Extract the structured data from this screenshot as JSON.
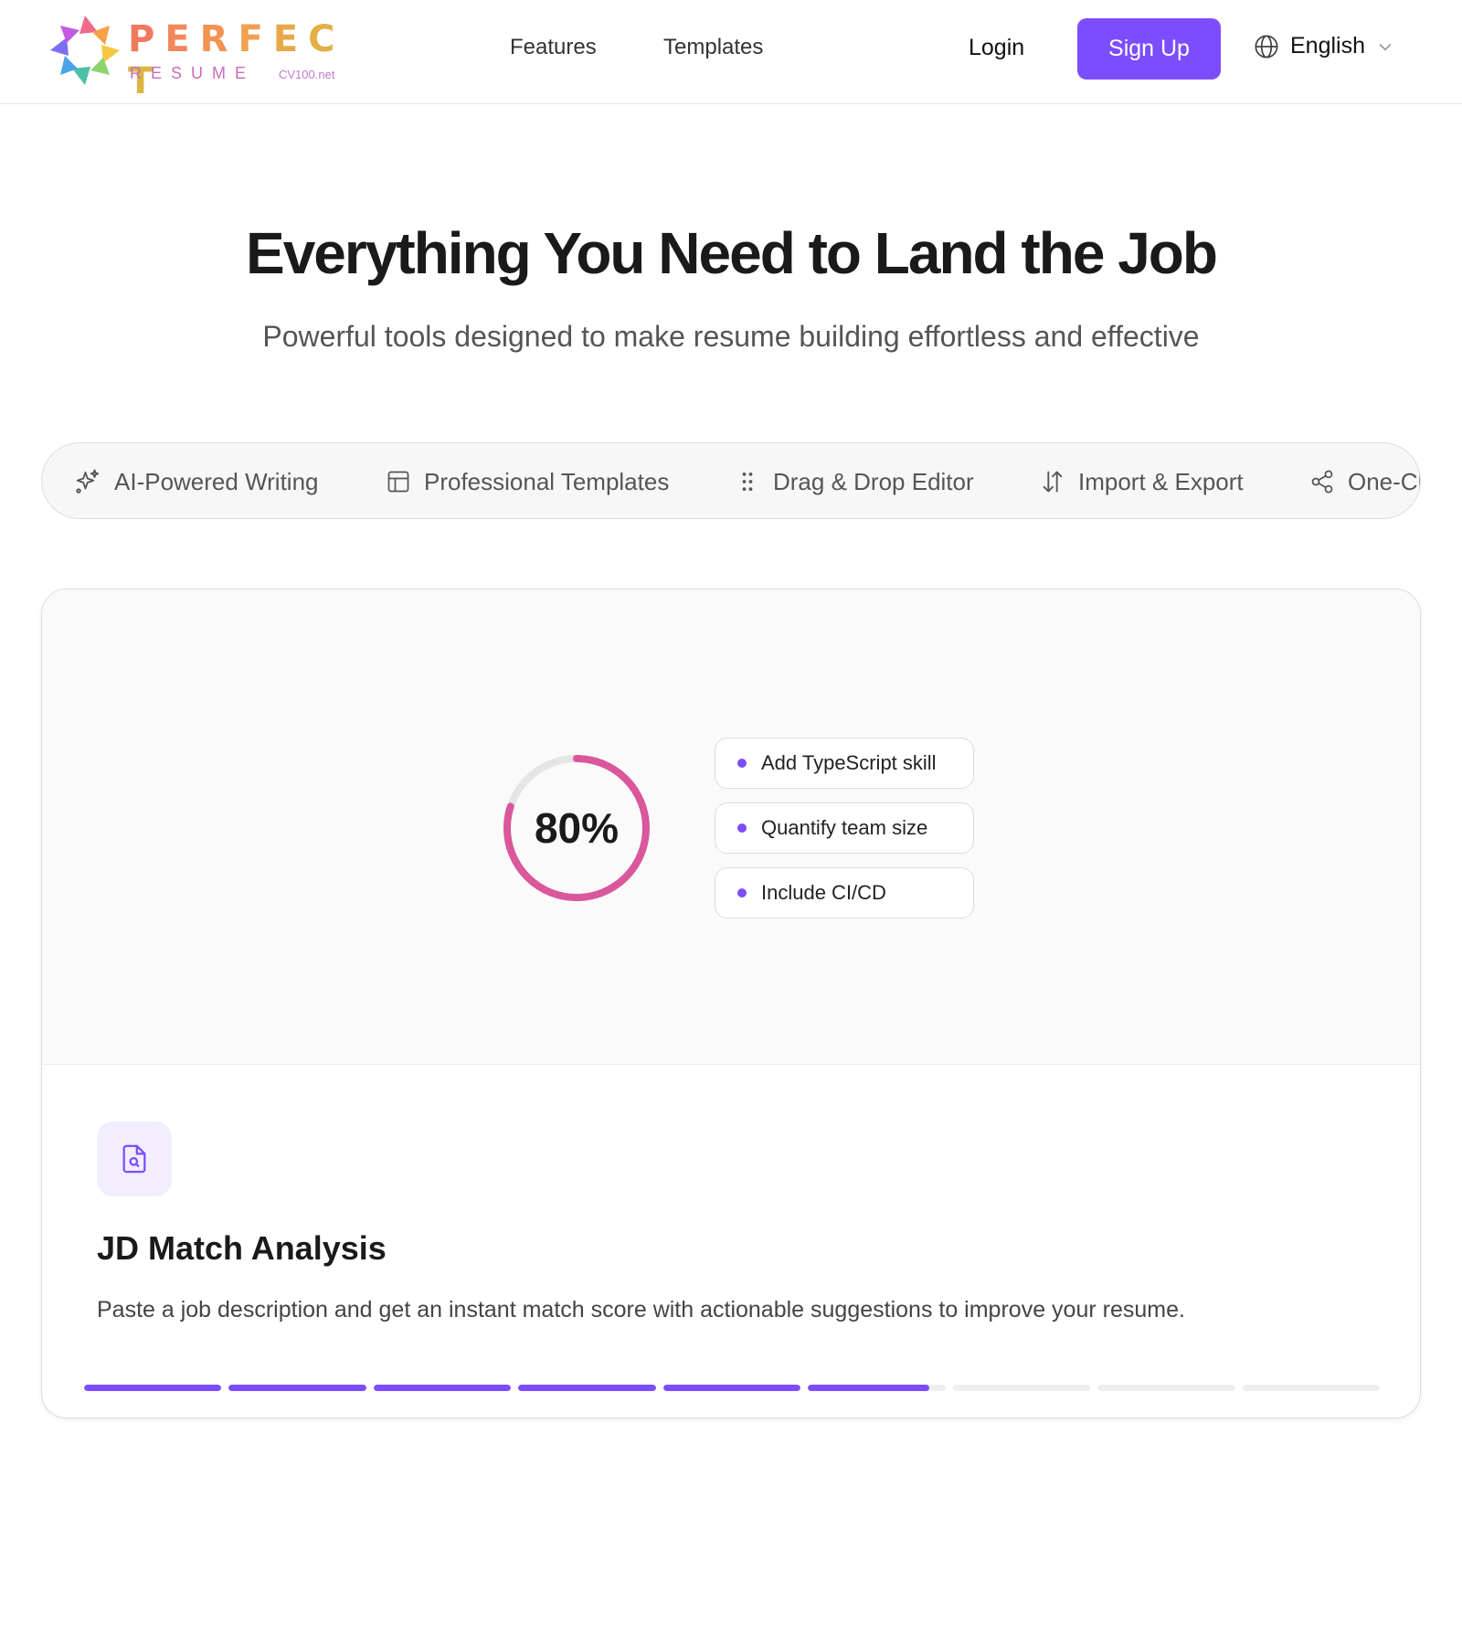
{
  "brand": {
    "wordmark": "PERFECT",
    "subtitle": "RESUME",
    "domain": "CV100.net",
    "wordmark_colors": [
      "#f07a5e",
      "#f3865c",
      "#f29354",
      "#f0a04e",
      "#e8a84a",
      "#e3b048",
      "#dcb545"
    ]
  },
  "nav": {
    "features": "Features",
    "templates": "Templates",
    "login": "Login",
    "signup": "Sign Up",
    "language": "English"
  },
  "hero": {
    "title": "Everything You Need to Land the Job",
    "subtitle": "Powerful tools designed to make resume building effortless and effective"
  },
  "tabs": [
    {
      "label": "AI-Powered Writing",
      "icon": "sparkles-icon"
    },
    {
      "label": "Professional Templates",
      "icon": "layout-icon"
    },
    {
      "label": "Drag & Drop Editor",
      "icon": "grip-icon"
    },
    {
      "label": "Import & Export",
      "icon": "arrows-up-down-icon"
    },
    {
      "label": "One-Cl",
      "icon": "share-icon"
    }
  ],
  "feature": {
    "score_label": "80%",
    "score_value": 0.8,
    "suggestions": [
      "Add TypeScript skill",
      "Quantify team size",
      "Include CI/CD"
    ],
    "icon": "file-search-icon",
    "title": "JD Match Analysis",
    "description": "Paste a job description and get an instant match score with actionable suggestions to improve your resume."
  },
  "carousel_progress": {
    "segments": 9,
    "active_fill": [
      1,
      1,
      1,
      1,
      1,
      0.88,
      0,
      0,
      0
    ]
  },
  "colors": {
    "accent": "#7c4dff",
    "ring": "#d9579a",
    "ring_track": "#e5e5e5"
  }
}
